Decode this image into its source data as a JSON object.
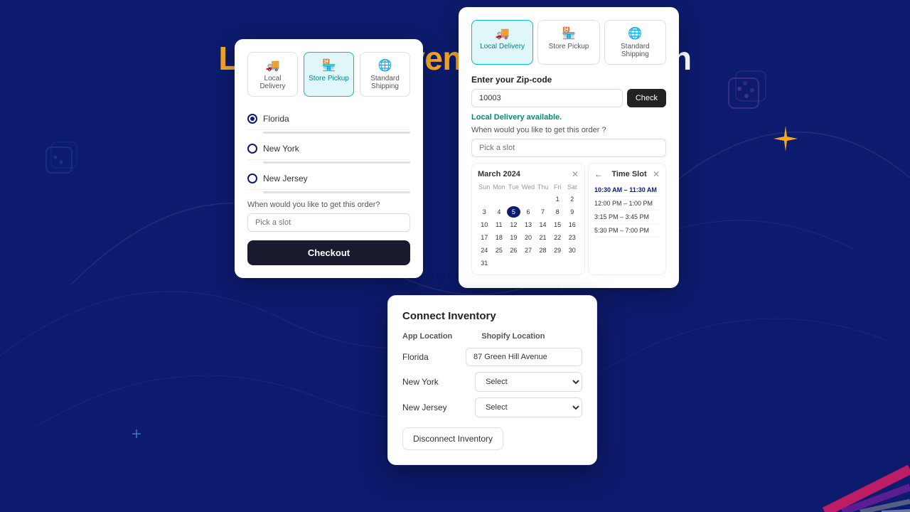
{
  "page": {
    "title_orange": "Location-Driven",
    "title_white": "Customization"
  },
  "left_card": {
    "tabs": [
      {
        "label": "Local Delivery",
        "icon": "🚚",
        "active": false
      },
      {
        "label": "Store Pickup",
        "icon": "🏪",
        "active": true
      },
      {
        "label": "Standard Shipping",
        "icon": "🌐",
        "active": false
      }
    ],
    "locations": [
      {
        "name": "Florida",
        "selected": true
      },
      {
        "name": "New York",
        "selected": false
      },
      {
        "name": "New Jersey",
        "selected": false
      }
    ],
    "when_label": "When would you like to get this order?",
    "pick_slot_placeholder": "Pick a slot",
    "checkout_label": "Checkout"
  },
  "right_card": {
    "tabs": [
      {
        "label": "Local Delivery",
        "icon": "🚚",
        "active": true
      },
      {
        "label": "Store Pickup",
        "icon": "🏪",
        "active": false
      },
      {
        "label": "Standard Shipping",
        "icon": "🌐",
        "active": false
      }
    ],
    "zipcode_label": "Enter your Zip-code",
    "zipcode_value": "10003",
    "check_btn": "Check",
    "delivery_available": "Local Delivery available.",
    "when_label": "When would you like to get this order ?",
    "pick_slot_placeholder": "Pick a slot",
    "calendar": {
      "title": "March 2024",
      "day_names": [
        "Sun",
        "Mon",
        "Tue",
        "Wed",
        "Thu",
        "Fri",
        "Sat"
      ],
      "days": [
        "",
        "",
        "",
        "",
        "",
        "1",
        "2",
        "3",
        "4",
        "5",
        "6",
        "7",
        "8",
        "9",
        "10",
        "11",
        "12",
        "13",
        "14",
        "15",
        "16",
        "17",
        "18",
        "19",
        "20",
        "21",
        "22",
        "23",
        "24",
        "25",
        "26",
        "27",
        "28",
        "29",
        "30",
        "31"
      ],
      "today": "5"
    },
    "time_slots": {
      "title": "Time Slot",
      "items": [
        {
          "label": "10:30 AM – 11:30 AM",
          "selected": true
        },
        {
          "label": "12:00 PM – 1:00 PM",
          "selected": false
        },
        {
          "label": "3:15 PM – 3:45 PM",
          "selected": false
        },
        {
          "label": "5:30 PM – 7:00 PM",
          "selected": false
        }
      ]
    }
  },
  "modal": {
    "title": "Connect Inventory",
    "col_app": "App Location",
    "col_shopify": "Shopify Location",
    "rows": [
      {
        "location": "Florida",
        "shopify_value": "87 Green Hill Avenue",
        "type": "value"
      },
      {
        "location": "New York",
        "shopify_value": "Select",
        "type": "select"
      },
      {
        "location": "New Jersey",
        "shopify_value": "Select",
        "type": "select"
      }
    ],
    "disconnect_label": "Disconnect Inventory"
  }
}
